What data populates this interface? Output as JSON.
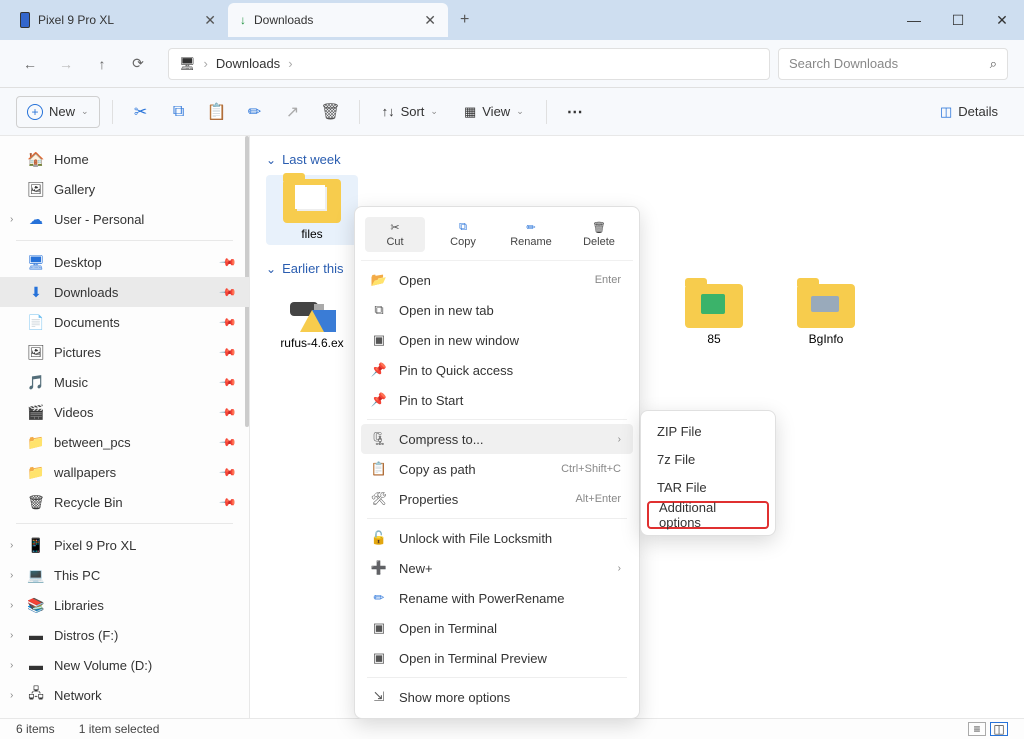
{
  "titlebar": {
    "tabs": [
      {
        "label": "Pixel 9 Pro XL",
        "active": false
      },
      {
        "label": "Downloads",
        "active": true
      }
    ]
  },
  "addressbar": {
    "path": "Downloads",
    "search_placeholder": "Search Downloads"
  },
  "toolbar": {
    "new_label": "New",
    "sort_label": "Sort",
    "view_label": "View",
    "details_label": "Details"
  },
  "sidebar": {
    "top": [
      {
        "label": "Home",
        "icon": "🏠"
      },
      {
        "label": "Gallery",
        "icon": "🖼"
      },
      {
        "label": "User - Personal",
        "icon": "☁",
        "chev": true
      }
    ],
    "quick": [
      {
        "label": "Desktop",
        "icon": "🖥",
        "pin": true
      },
      {
        "label": "Downloads",
        "icon": "⬇",
        "pin": true,
        "selected": true
      },
      {
        "label": "Documents",
        "icon": "📄",
        "pin": true
      },
      {
        "label": "Pictures",
        "icon": "🖼",
        "pin": true
      },
      {
        "label": "Music",
        "icon": "🎵",
        "pin": true
      },
      {
        "label": "Videos",
        "icon": "🎬",
        "pin": true
      },
      {
        "label": "between_pcs",
        "icon": "📁",
        "pin": true
      },
      {
        "label": "wallpapers",
        "icon": "📁",
        "pin": true
      },
      {
        "label": "Recycle Bin",
        "icon": "🗑",
        "pin": true
      }
    ],
    "bottom": [
      {
        "label": "Pixel 9 Pro XL",
        "icon": "📱",
        "chev": true
      },
      {
        "label": "This PC",
        "icon": "💻",
        "chev": true
      },
      {
        "label": "Libraries",
        "icon": "📚",
        "chev": true
      },
      {
        "label": "Distros (F:)",
        "icon": "▬",
        "chev": true
      },
      {
        "label": "New Volume (D:)",
        "icon": "▬",
        "chev": true
      },
      {
        "label": "Network",
        "icon": "🖧",
        "chev": true
      }
    ]
  },
  "content": {
    "groups": [
      {
        "label": "Last week",
        "items": [
          {
            "name": "files",
            "type": "folder",
            "selected": true
          }
        ]
      },
      {
        "label": "Earlier this",
        "items": [
          {
            "name": "rufus-4.6.ex",
            "type": "exe"
          },
          {
            "name": "85",
            "type": "folder-app"
          },
          {
            "name": "BgInfo",
            "type": "folder-app"
          }
        ]
      }
    ]
  },
  "context_menu": {
    "top": [
      {
        "label": "Cut",
        "hov": true
      },
      {
        "label": "Copy"
      },
      {
        "label": "Rename"
      },
      {
        "label": "Delete"
      }
    ],
    "rows": [
      {
        "label": "Open",
        "shortcut": "Enter",
        "icon": "📂"
      },
      {
        "label": "Open in new tab",
        "icon": "⧉"
      },
      {
        "label": "Open in new window",
        "icon": "▣"
      },
      {
        "label": "Pin to Quick access",
        "icon": "📌"
      },
      {
        "label": "Pin to Start",
        "icon": "📌"
      },
      {
        "sep": true
      },
      {
        "label": "Compress to...",
        "arrow": true,
        "icon": "🗜",
        "hov": true
      },
      {
        "label": "Copy as path",
        "shortcut": "Ctrl+Shift+C",
        "icon": "📋"
      },
      {
        "label": "Properties",
        "shortcut": "Alt+Enter",
        "icon": "🛠"
      },
      {
        "sep": true
      },
      {
        "label": "Unlock with File Locksmith",
        "icon": "🔓"
      },
      {
        "label": "New+",
        "icon": "➕"
      },
      {
        "label": "Rename with PowerRename",
        "icon": "✏"
      },
      {
        "label": "Open in Terminal",
        "icon": "▣"
      },
      {
        "label": "Open in Terminal Preview",
        "icon": "▣"
      },
      {
        "sep": true
      },
      {
        "label": "Show more options",
        "icon": "⇲"
      }
    ]
  },
  "submenu": {
    "rows": [
      {
        "label": "ZIP File"
      },
      {
        "label": "7z File"
      },
      {
        "label": "TAR File"
      },
      {
        "label": "Additional options",
        "highlight": true
      }
    ]
  },
  "statusbar": {
    "count": "6 items",
    "selection": "1 item selected"
  }
}
